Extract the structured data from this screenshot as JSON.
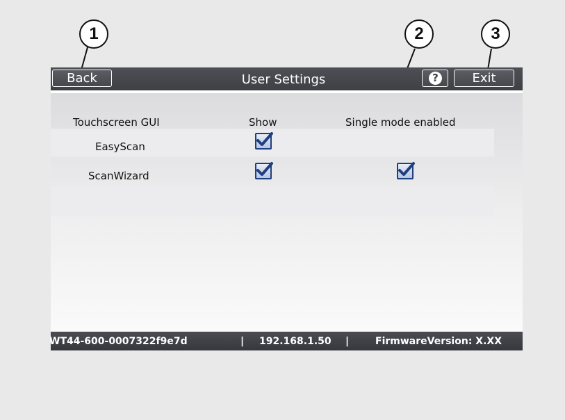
{
  "callouts": [
    "1",
    "2",
    "3"
  ],
  "topbar": {
    "back_label": "Back",
    "title": "User Settings",
    "help_label": "?",
    "exit_label": "Exit"
  },
  "table": {
    "headers": [
      "Touchscreen GUI",
      "Show",
      "Single mode enabled"
    ],
    "rows": [
      {
        "label": "EasyScan",
        "show": true,
        "single_mode": false
      },
      {
        "label": "ScanWizard",
        "show": true,
        "single_mode": true
      }
    ]
  },
  "statusbar": {
    "device_id": "WT44-600-0007322f9e7d",
    "separator": "|",
    "ip": "192.168.1.50",
    "firmware": "FirmwareVersion: X.XX"
  },
  "colors": {
    "bar": "#45474c",
    "checkbox_border": "#1f3f80",
    "checkmark": "#1f3f80"
  }
}
